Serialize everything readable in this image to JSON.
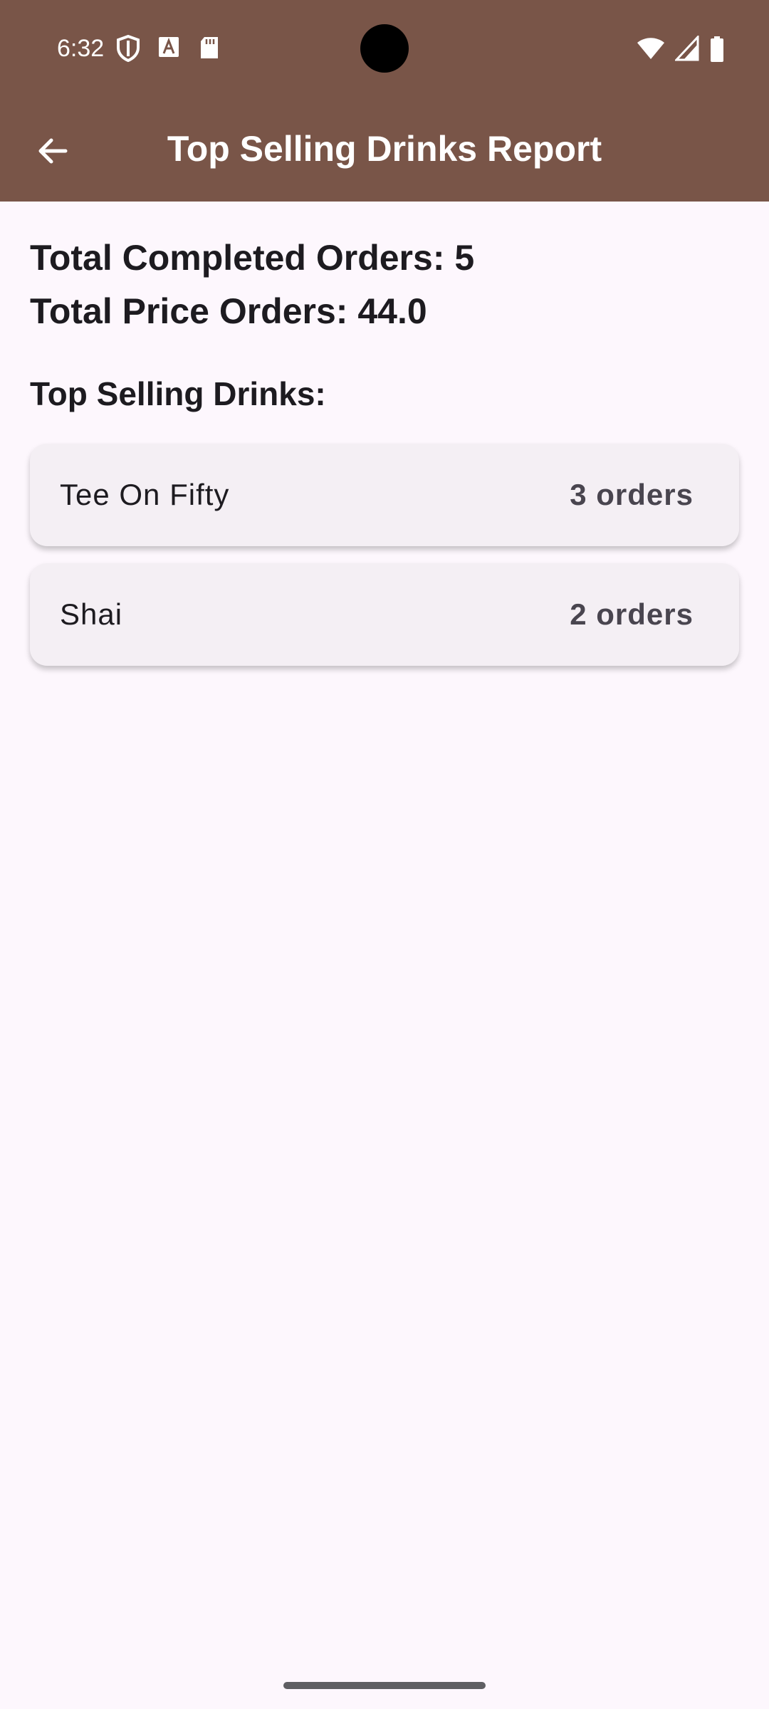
{
  "status_bar": {
    "time": "6:32",
    "left_icons": [
      "shield-icon",
      "keyboard-a-icon",
      "sd-card-icon"
    ],
    "right_icons": [
      "wifi-icon",
      "cell-signal-icon",
      "battery-icon"
    ]
  },
  "app_bar": {
    "title": "Top Selling Drinks Report",
    "back_icon": "arrow-back-icon",
    "color": "#795548"
  },
  "summary": {
    "completed_orders": "Total Completed Orders: 5",
    "total_price": "Total Price Orders: 44.0"
  },
  "top_selling": {
    "heading": "Top Selling Drinks:",
    "items": [
      {
        "name": "Tee On Fifty",
        "count": "3 orders"
      },
      {
        "name": "Shai",
        "count": "2 orders"
      }
    ]
  },
  "colors": {
    "background": "#fdf7fd",
    "card": "#f4eff4",
    "text_primary": "#1d1b20",
    "text_secondary": "#49454f"
  }
}
